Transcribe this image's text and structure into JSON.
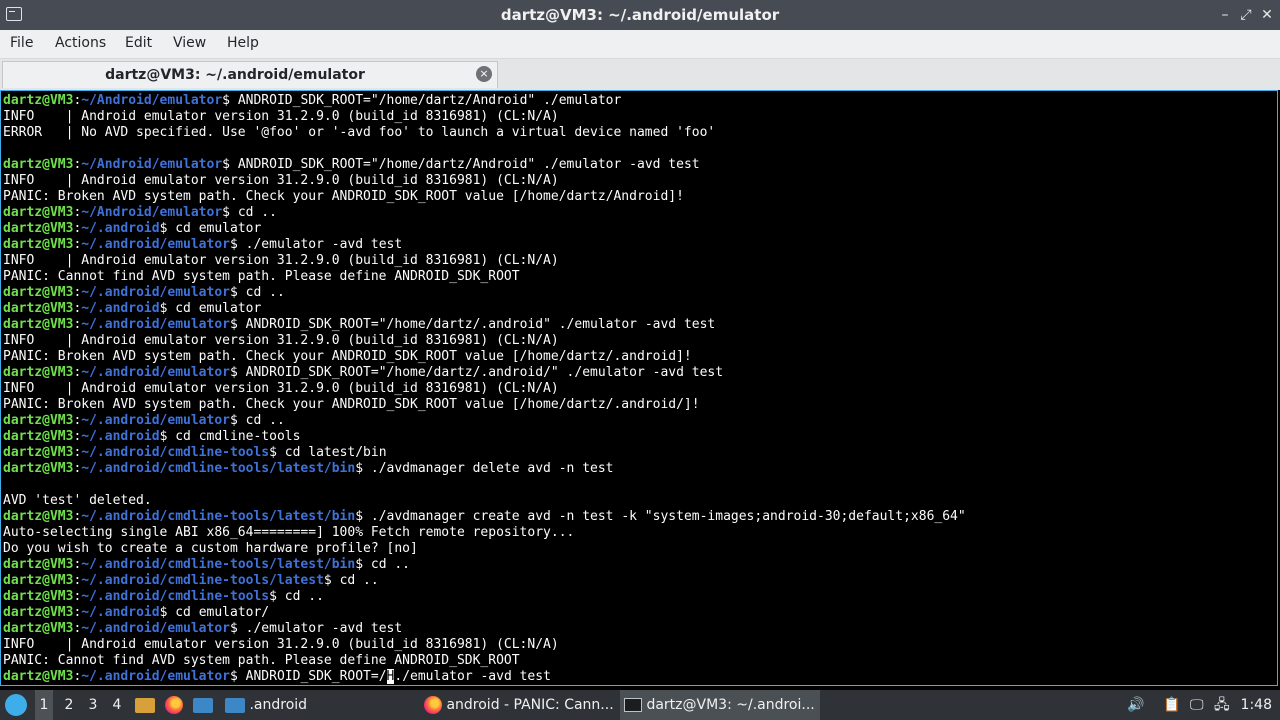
{
  "window": {
    "title": "dartz@VM3: ~/.android/emulator",
    "controls": {
      "minimize": "–",
      "maximize": "⤢",
      "close": "✕"
    }
  },
  "menubar": {
    "items": [
      "File",
      "Actions",
      "Edit",
      "View",
      "Help"
    ]
  },
  "tab": {
    "label": "dartz@VM3: ~/.android/emulator",
    "close_icon": "×"
  },
  "terminal": {
    "user_host": "dartz@VM3",
    "lines": [
      {
        "type": "prompt",
        "path": "~/Android/emulator",
        "cmd": "ANDROID_SDK_ROOT=\"/home/dartz/Android\" ./emulator"
      },
      {
        "type": "out",
        "text": "INFO    | Android emulator version 31.2.9.0 (build_id 8316981) (CL:N/A)"
      },
      {
        "type": "out",
        "text": "ERROR   | No AVD specified. Use '@foo' or '-avd foo' to launch a virtual device named 'foo'"
      },
      {
        "type": "out",
        "text": ""
      },
      {
        "type": "prompt",
        "path": "~/Android/emulator",
        "cmd": "ANDROID_SDK_ROOT=\"/home/dartz/Android\" ./emulator -avd test"
      },
      {
        "type": "out",
        "text": "INFO    | Android emulator version 31.2.9.0 (build_id 8316981) (CL:N/A)"
      },
      {
        "type": "out",
        "text": "PANIC: Broken AVD system path. Check your ANDROID_SDK_ROOT value [/home/dartz/Android]!"
      },
      {
        "type": "prompt",
        "path": "~/Android/emulator",
        "cmd": "cd .."
      },
      {
        "type": "prompt",
        "path": "~/.android",
        "cmd": "cd emulator"
      },
      {
        "type": "prompt",
        "path": "~/.android/emulator",
        "cmd": "./emulator -avd test"
      },
      {
        "type": "out",
        "text": "INFO    | Android emulator version 31.2.9.0 (build_id 8316981) (CL:N/A)"
      },
      {
        "type": "out",
        "text": "PANIC: Cannot find AVD system path. Please define ANDROID_SDK_ROOT"
      },
      {
        "type": "prompt",
        "path": "~/.android/emulator",
        "cmd": "cd .."
      },
      {
        "type": "prompt",
        "path": "~/.android",
        "cmd": "cd emulator"
      },
      {
        "type": "prompt",
        "path": "~/.android/emulator",
        "cmd": "ANDROID_SDK_ROOT=\"/home/dartz/.android\" ./emulator -avd test"
      },
      {
        "type": "out",
        "text": "INFO    | Android emulator version 31.2.9.0 (build_id 8316981) (CL:N/A)"
      },
      {
        "type": "out",
        "text": "PANIC: Broken AVD system path. Check your ANDROID_SDK_ROOT value [/home/dartz/.android]!"
      },
      {
        "type": "prompt",
        "path": "~/.android/emulator",
        "cmd": "ANDROID_SDK_ROOT=\"/home/dartz/.android/\" ./emulator -avd test"
      },
      {
        "type": "out",
        "text": "INFO    | Android emulator version 31.2.9.0 (build_id 8316981) (CL:N/A)"
      },
      {
        "type": "out",
        "text": "PANIC: Broken AVD system path. Check your ANDROID_SDK_ROOT value [/home/dartz/.android/]!"
      },
      {
        "type": "prompt",
        "path": "~/.android/emulator",
        "cmd": "cd .."
      },
      {
        "type": "prompt",
        "path": "~/.android",
        "cmd": "cd cmdline-tools"
      },
      {
        "type": "prompt",
        "path": "~/.android/cmdline-tools",
        "cmd": "cd latest/bin"
      },
      {
        "type": "prompt",
        "path": "~/.android/cmdline-tools/latest/bin",
        "cmd": "./avdmanager delete avd -n test"
      },
      {
        "type": "out",
        "text": ""
      },
      {
        "type": "out",
        "text": "AVD 'test' deleted."
      },
      {
        "type": "prompt",
        "path": "~/.android/cmdline-tools/latest/bin",
        "cmd": "./avdmanager create avd -n test -k \"system-images;android-30;default;x86_64\""
      },
      {
        "type": "out",
        "text": "Auto-selecting single ABI x86_64========] 100% Fetch remote repository..."
      },
      {
        "type": "out",
        "text": "Do you wish to create a custom hardware profile? [no]"
      },
      {
        "type": "prompt",
        "path": "~/.android/cmdline-tools/latest/bin",
        "cmd": "cd .."
      },
      {
        "type": "prompt",
        "path": "~/.android/cmdline-tools/latest",
        "cmd": "cd .."
      },
      {
        "type": "prompt",
        "path": "~/.android/cmdline-tools",
        "cmd": "cd .."
      },
      {
        "type": "prompt",
        "path": "~/.android",
        "cmd": "cd emulator/"
      },
      {
        "type": "prompt",
        "path": "~/.android/emulator",
        "cmd": "./emulator -avd test"
      },
      {
        "type": "out",
        "text": "INFO    | Android emulator version 31.2.9.0 (build_id 8316981) (CL:N/A)"
      },
      {
        "type": "out",
        "text": "PANIC: Cannot find AVD system path. Please define ANDROID_SDK_ROOT"
      },
      {
        "type": "input",
        "path": "~/.android/emulator",
        "before": "ANDROID_SDK_ROOT=/H",
        "cursor": "H",
        "after": "./emulator -avd test"
      }
    ]
  },
  "taskbar": {
    "workspaces": [
      "1",
      "2",
      "3",
      "4"
    ],
    "active_workspace": "1",
    "folder_label": ".android",
    "firefox_task": "android - PANIC: Cann...",
    "terminal_task": "dartz@VM3: ~/.androi...",
    "clock": "1:48"
  },
  "colors": {
    "prompt_user": "#6ee04c",
    "prompt_path": "#3f72d9",
    "accent": "#3daee9"
  }
}
